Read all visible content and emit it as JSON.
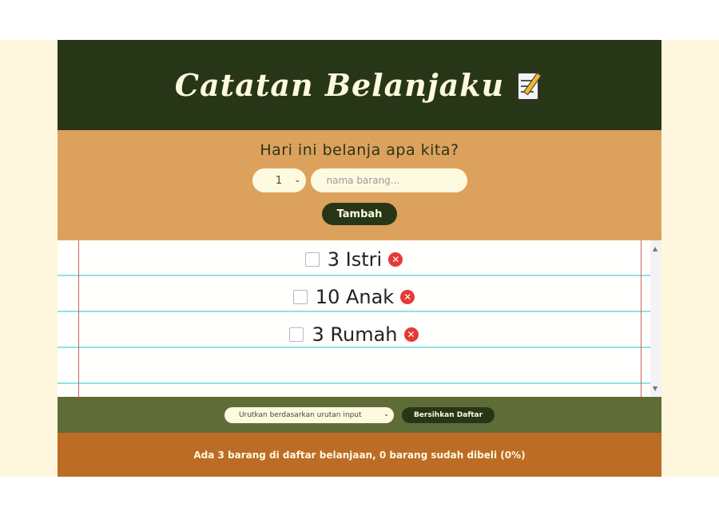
{
  "header": {
    "title": "Catatan Belanjaku",
    "icon": "memo-icon"
  },
  "form": {
    "title": "Hari ini belanja apa kita?",
    "quantity_value": "1",
    "name_placeholder": "nama barang...",
    "add_label": "Tambah"
  },
  "list": {
    "items": [
      {
        "text": "3 Istri",
        "checked": false
      },
      {
        "text": "10 Anak",
        "checked": false
      },
      {
        "text": "3 Rumah",
        "checked": false
      }
    ]
  },
  "actions": {
    "sort_value": "Urutkan berdasarkan urutan input",
    "clear_label": "Bersihkan Daftar"
  },
  "stats": {
    "text": "Ada 3 barang di daftar belanjaan, 0 barang sudah dibeli (0%)"
  },
  "colors": {
    "header_bg": "#283618",
    "form_bg": "#dda15e",
    "actions_bg": "#606c38",
    "stats_bg": "#bc6c25",
    "delete_red": "#e53935"
  }
}
